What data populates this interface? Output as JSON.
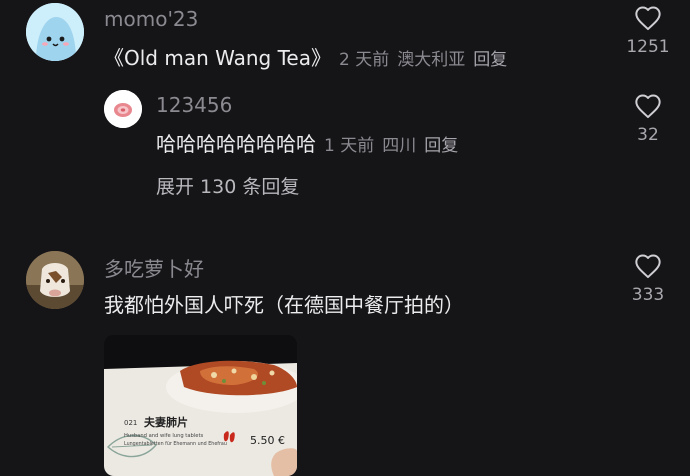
{
  "comments": [
    {
      "username": "momo'23",
      "text": "《Old man Wang Tea》",
      "time": "2 天前",
      "location": "澳大利亚",
      "reply_label": "回复",
      "likes": "1251",
      "replies": [
        {
          "username": "123456",
          "text": "哈哈哈哈哈哈哈哈",
          "time": "1 天前",
          "location": "四川",
          "reply_label": "回复",
          "likes": "32"
        }
      ],
      "expand_label": "展开 130 条回复"
    },
    {
      "username": "多吃萝卜好",
      "text": "我都怕外国人吓死（在德国中餐厅拍的）",
      "likes": "333",
      "image": {
        "dish_number": "021",
        "dish_name": "夫妻肺片",
        "dish_price": "5.50 €",
        "dish_desc_en": "Husband and wife lung tablets",
        "dish_desc_de": "Lungentabletten für Ehemann und Ehefrau"
      }
    }
  ],
  "colors": {
    "background": "#151417",
    "text_primary": "#ececee",
    "text_secondary": "#8b8a90"
  },
  "icons": {
    "like": "heart-outline-icon"
  }
}
